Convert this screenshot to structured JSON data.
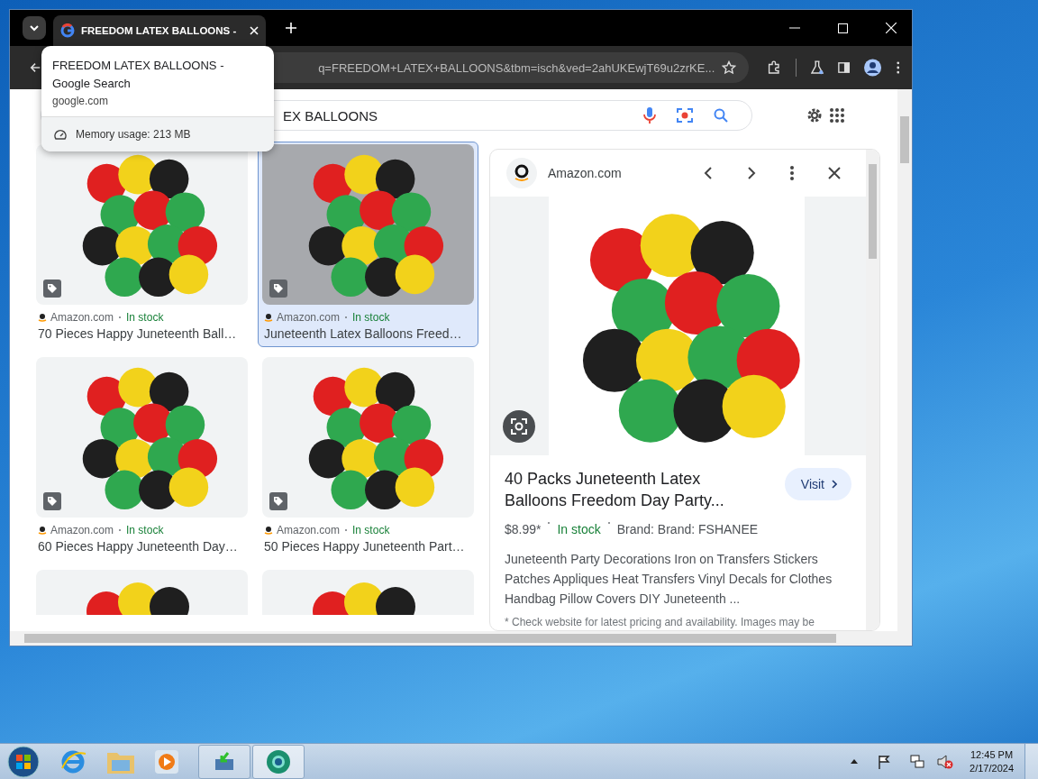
{
  "tabs": [
    {
      "title": "FREEDOM LATEX BALLOONS -",
      "selected": true
    }
  ],
  "address_bar": {
    "url": "q=FREEDOM+LATEX+BALLOONS&tbm=isch&ved=2ahUKEwjT69u2zrKE..."
  },
  "hover_card": {
    "title": "FREEDOM LATEX BALLOONS - Google Search",
    "domain": "google.com",
    "memory": "Memory usage: 213 MB"
  },
  "search": {
    "value": "EX BALLOONS"
  },
  "results": [
    {
      "kind": "card",
      "source": "Amazon.com",
      "stock": "In stock",
      "title": "70 Pieces Happy Juneteenth Ball…",
      "selected": false
    },
    {
      "kind": "card",
      "source": "Amazon.com",
      "stock": "In stock",
      "title": "Juneteenth Latex Balloons Freed…",
      "selected": true
    },
    {
      "kind": "card",
      "source": "Amazon.com",
      "stock": "In stock",
      "title": "60 Pieces Happy Juneteenth Day…",
      "selected": false
    },
    {
      "kind": "card",
      "source": "Amazon.com",
      "stock": "In stock",
      "title": "50 Pieces Happy Juneteenth Part…",
      "selected": false
    },
    {
      "kind": "partial"
    },
    {
      "kind": "partial"
    }
  ],
  "preview": {
    "source": "Amazon.com",
    "title": "40 Packs Juneteenth Latex Balloons Freedom Day Party...",
    "visit": "Visit",
    "price": "$8.99*",
    "stock": "In stock",
    "brand": "Brand: Brand: FSHANEE",
    "description": "Juneteenth Party Decorations Iron on Transfers Stickers Patches Appliques Heat Transfers Vinyl Decals for Clothes Handbag Pillow Covers DIY Juneteenth ...",
    "note": "* Check website for latest pricing and availability. Images may be"
  },
  "taskbar": {
    "time": "12:45 PM",
    "date": "2/17/2024"
  }
}
